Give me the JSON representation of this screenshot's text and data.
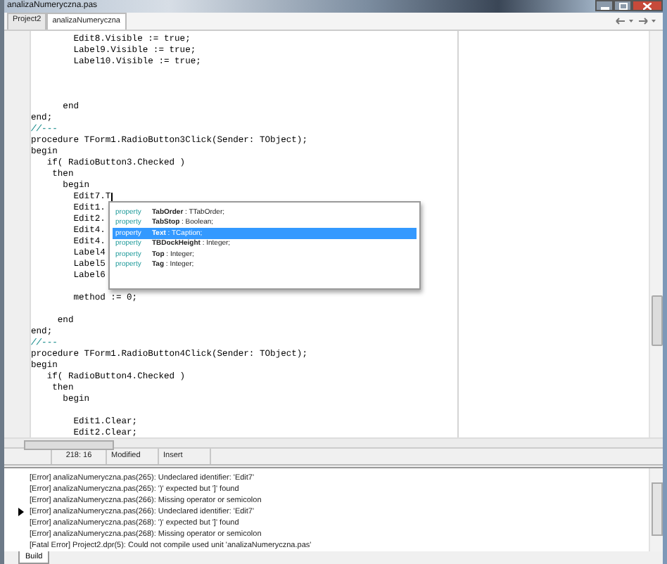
{
  "window": {
    "title": "analizaNumeryczna.pas"
  },
  "tabs": [
    {
      "label": "Project2",
      "selected": false
    },
    {
      "label": "analizaNumeryczna",
      "selected": true
    }
  ],
  "editor": {
    "lines": [
      {
        "kind": "code",
        "text": "        Edit8.Visible := true;",
        "caret": false
      },
      {
        "kind": "code",
        "text": "        Label9.Visible := true;",
        "caret": false
      },
      {
        "kind": "code",
        "text": "        Label10.Visible := true;",
        "caret": false
      },
      {
        "kind": "blank"
      },
      {
        "kind": "blank"
      },
      {
        "kind": "blank"
      },
      {
        "kind": "code",
        "text": "      end",
        "caret": false
      },
      {
        "kind": "code",
        "text": "end;",
        "caret": false
      },
      {
        "kind": "comment",
        "text": "//---",
        "caret": false
      },
      {
        "kind": "code",
        "text": "procedure TForm1.RadioButton3Click(Sender: TObject);",
        "caret": false
      },
      {
        "kind": "code",
        "text": "begin",
        "caret": false
      },
      {
        "kind": "code",
        "text": "   if( RadioButton3.Checked )",
        "caret": false
      },
      {
        "kind": "code",
        "text": "    then",
        "caret": false
      },
      {
        "kind": "code",
        "text": "      begin",
        "caret": false
      },
      {
        "kind": "code",
        "text": "        Edit7.T",
        "caret": true
      },
      {
        "kind": "code",
        "text": "        Edit1.",
        "caret": false
      },
      {
        "kind": "code",
        "text": "        Edit2.",
        "caret": false
      },
      {
        "kind": "code",
        "text": "        Edit4.",
        "caret": false
      },
      {
        "kind": "code",
        "text": "        Edit4.",
        "caret": false
      },
      {
        "kind": "code",
        "text": "        Label4",
        "caret": false
      },
      {
        "kind": "code",
        "text": "        Label5",
        "caret": false
      },
      {
        "kind": "code",
        "text": "        Label6",
        "caret": false
      },
      {
        "kind": "blank"
      },
      {
        "kind": "code",
        "text": "        method := 0;",
        "caret": false
      },
      {
        "kind": "blank"
      },
      {
        "kind": "code",
        "text": "     end",
        "caret": false
      },
      {
        "kind": "code",
        "text": "end;",
        "caret": false
      },
      {
        "kind": "comment",
        "text": "//---",
        "caret": false
      },
      {
        "kind": "code",
        "text": "procedure TForm1.RadioButton4Click(Sender: TObject);",
        "caret": false
      },
      {
        "kind": "code",
        "text": "begin",
        "caret": false
      },
      {
        "kind": "code",
        "text": "   if( RadioButton4.Checked )",
        "caret": false
      },
      {
        "kind": "code",
        "text": "    then",
        "caret": false
      },
      {
        "kind": "code",
        "text": "      begin",
        "caret": false
      },
      {
        "kind": "blank"
      },
      {
        "kind": "code",
        "text": "        Edit1.Clear;",
        "caret": false
      },
      {
        "kind": "code",
        "text": "        Edit2.Clear;",
        "caret": false
      }
    ],
    "completion": [
      {
        "category": "property",
        "name": "TabOrder",
        "type": ": TTabOrder;",
        "selected": false
      },
      {
        "category": "property",
        "name": "TabStop",
        "type": ": Boolean;",
        "selected": false
      },
      {
        "category": "property",
        "name": "Text",
        "type": ": TCaption;",
        "selected": true
      },
      {
        "category": "property",
        "name": "TBDockHeight",
        "type": ": Integer;",
        "selected": false
      },
      {
        "category": "property",
        "name": "Top",
        "type": ": Integer;",
        "selected": false
      },
      {
        "category": "property",
        "name": "Tag",
        "type": ": Integer;",
        "selected": false
      }
    ]
  },
  "status_bar": {
    "position": "218: 16",
    "modified": "Modified",
    "mode": "Insert"
  },
  "messages": [
    {
      "text": "[Error] analizaNumeryczna.pas(265): Undeclared identifier: 'Edit7'",
      "current": false
    },
    {
      "text": "[Error] analizaNumeryczna.pas(265): ')' expected but ']' found",
      "current": false
    },
    {
      "text": "[Error] analizaNumeryczna.pas(266): Missing operator or semicolon",
      "current": false
    },
    {
      "text": "[Error] analizaNumeryczna.pas(266): Undeclared identifier: 'Edit7'",
      "current": true
    },
    {
      "text": "[Error] analizaNumeryczna.pas(268): ')' expected but ']' found",
      "current": false
    },
    {
      "text": "[Error] analizaNumeryczna.pas(268): Missing operator or semicolon",
      "current": false
    },
    {
      "text": "[Fatal Error] Project2.dpr(5): Could not compile used unit 'analizaNumeryczna.pas'",
      "current": false
    }
  ],
  "bottom_tabs": [
    {
      "label": "Build",
      "selected": true
    }
  ]
}
